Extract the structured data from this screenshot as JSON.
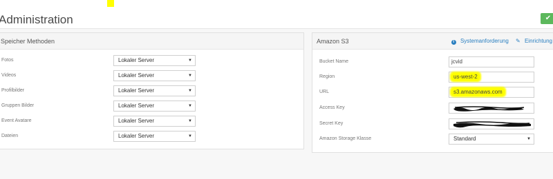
{
  "header": {
    "title": "Administration",
    "save_icon": "checkmark-icon"
  },
  "storage": {
    "title": "Speicher Methoden",
    "rows": [
      {
        "label": "Fotos",
        "value": "Lokaler Server"
      },
      {
        "label": "Videos",
        "value": "Lokaler Server"
      },
      {
        "label": "Profilbilder",
        "value": "Lokaler Server"
      },
      {
        "label": "Gruppen Bilder",
        "value": "Lokaler Server"
      },
      {
        "label": "Event Avatare",
        "value": "Lokaler Server"
      },
      {
        "label": "Dateien",
        "value": "Lokaler Server"
      }
    ]
  },
  "s3": {
    "title": "Amazon S3",
    "link_requirements": "Systemanforderung",
    "link_setup": "Einrichtung",
    "fields": {
      "bucket": {
        "label": "Bucket Name",
        "value": "jcvid"
      },
      "region": {
        "label": "Region",
        "value": "us-west-2"
      },
      "url": {
        "label": "URL",
        "value": "s3.amazonaws.com"
      },
      "access_key": {
        "label": "Access Key"
      },
      "secret_key": {
        "label": "Secret Key"
      },
      "storage_class": {
        "label": "Amazon Storage Klasse",
        "value": "Standard"
      }
    }
  },
  "colors": {
    "accent": "#2a7fc0",
    "success": "#5cb85c",
    "highlight": "#ffff00"
  }
}
